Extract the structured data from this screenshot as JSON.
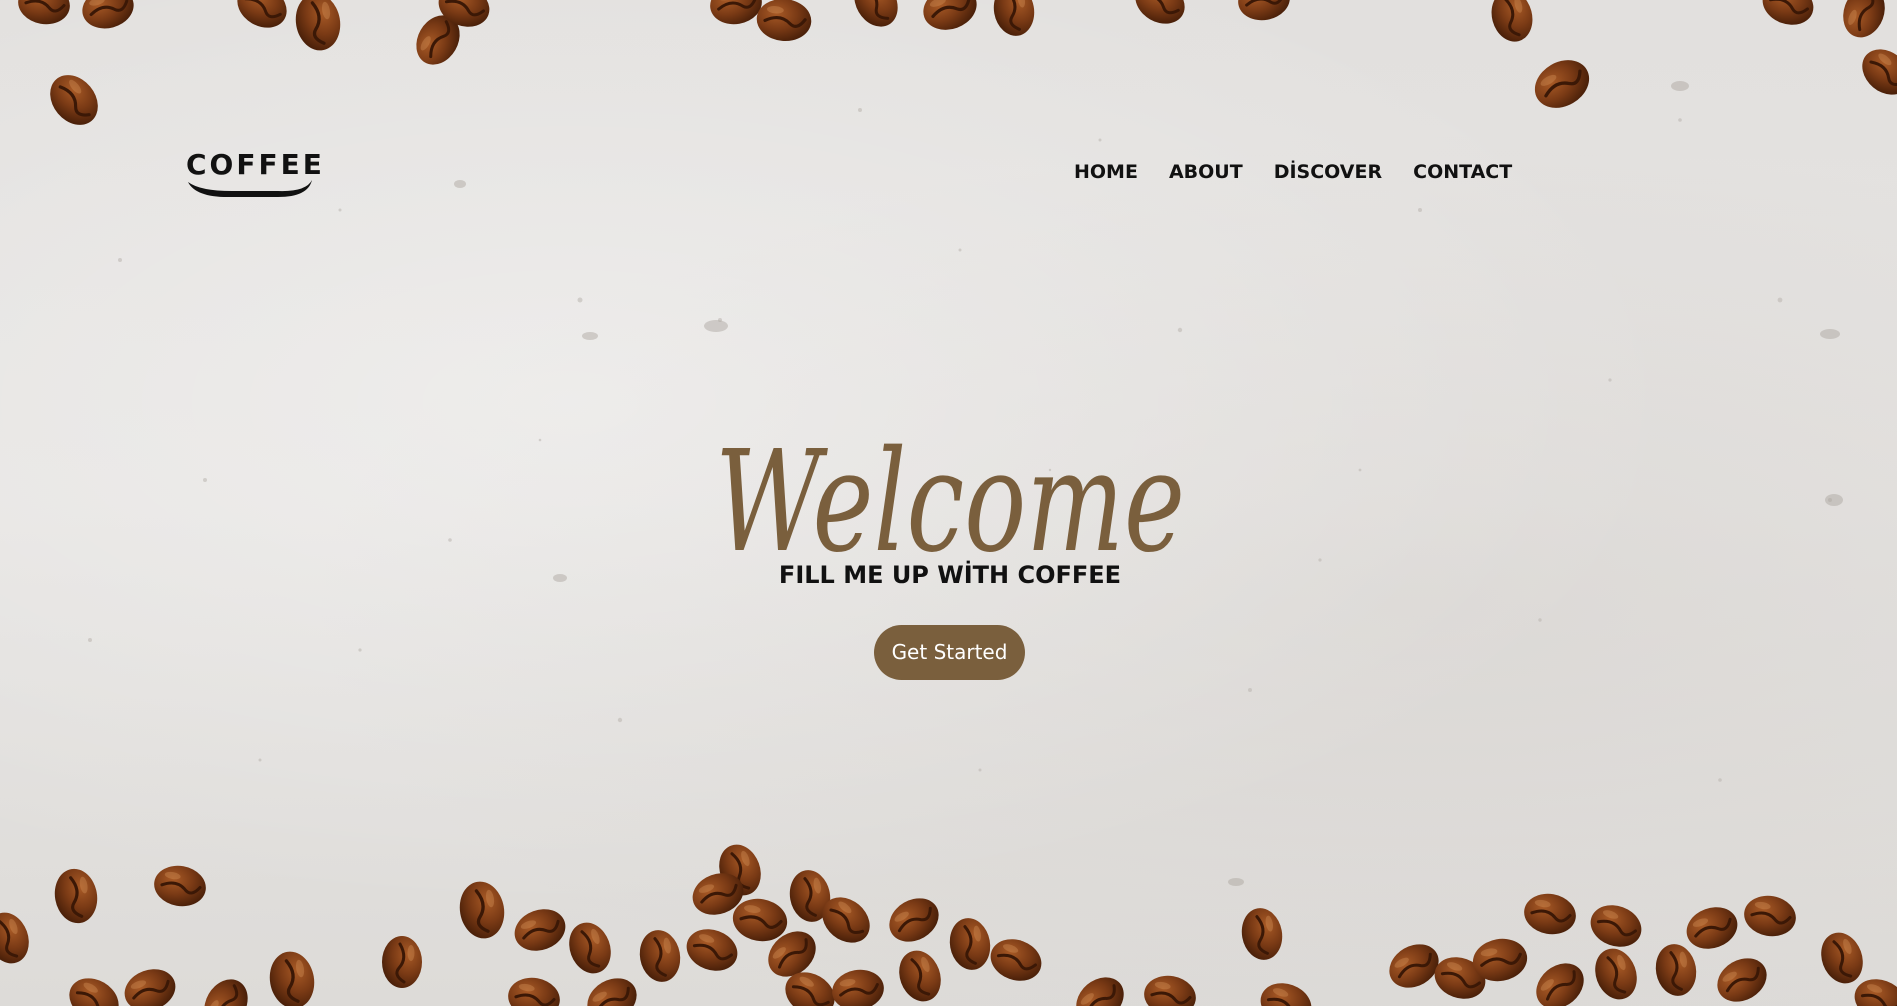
{
  "brand": {
    "name": "COFFEE"
  },
  "nav": {
    "items": [
      "HOME",
      "ABOUT",
      "DİSCOVER",
      "CONTACT"
    ]
  },
  "hero": {
    "title": "Welcome",
    "subtitle": "FILL ME UP WİTH COFFEE",
    "cta_label": "Get Started"
  },
  "colors": {
    "accent": "#7a5f3d",
    "background": "#e4e2e0",
    "bean": "#6e3514",
    "text": "#111111"
  }
}
